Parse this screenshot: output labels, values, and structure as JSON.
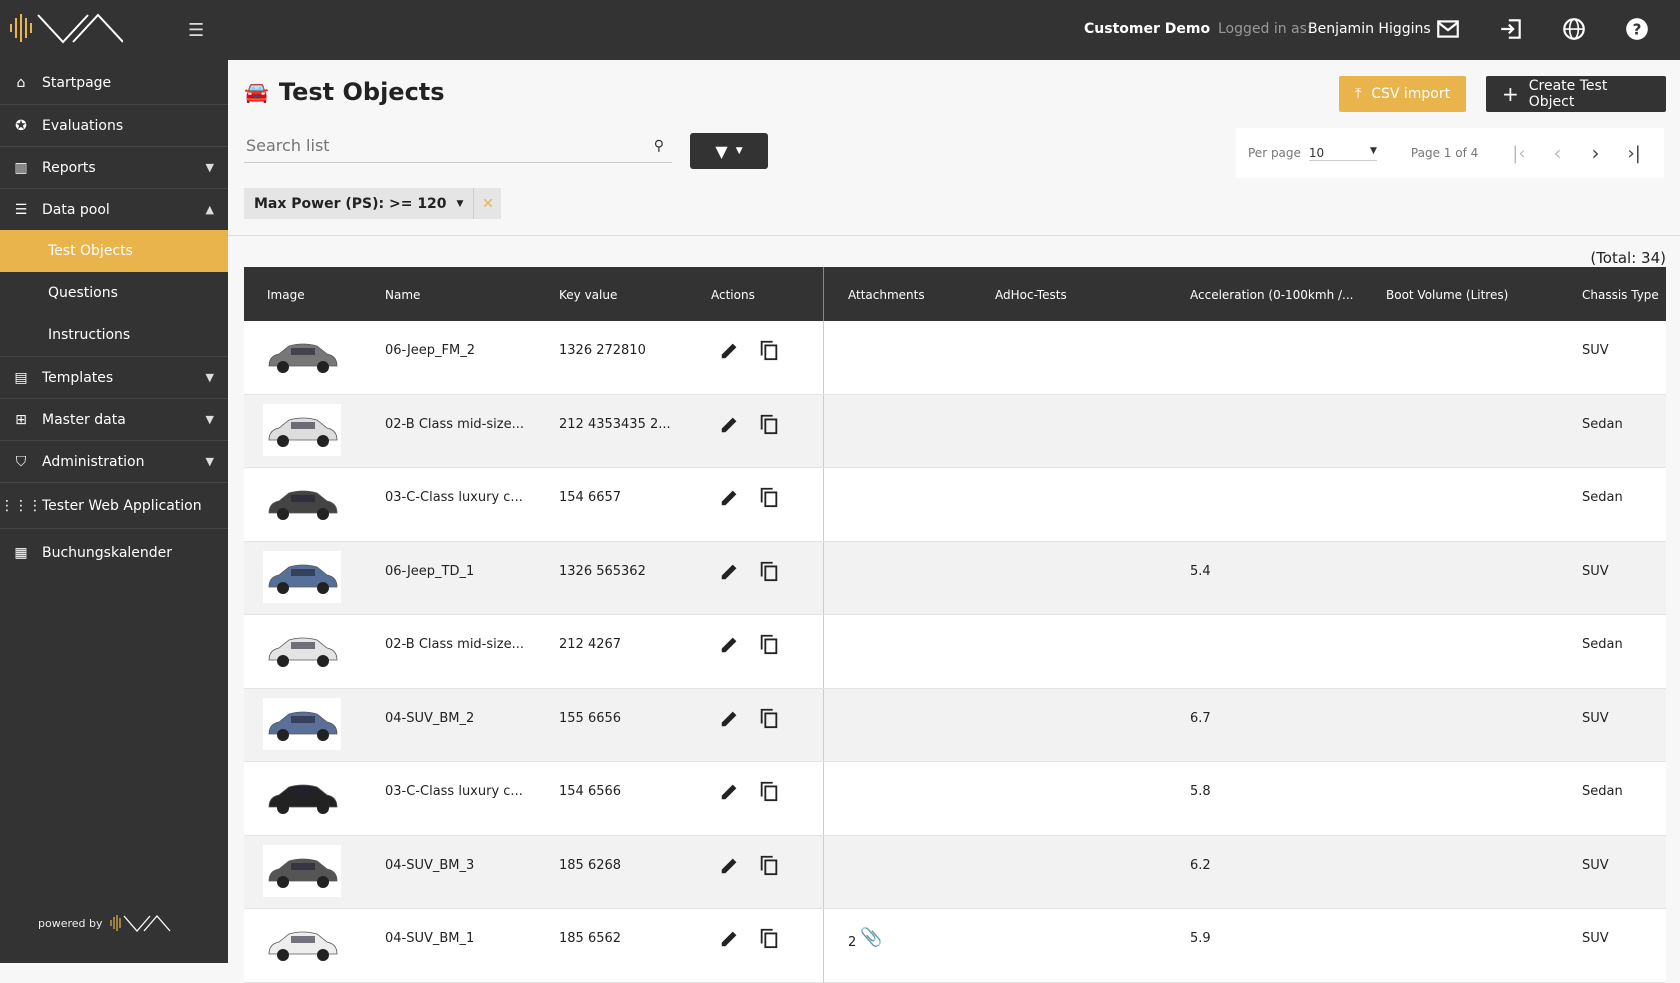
{
  "topbar": {
    "customer": "Customer Demo",
    "logged_in_label": "Logged in as:",
    "user": "Benjamin Higgins"
  },
  "sidebar": {
    "items": [
      {
        "label": "Startpage",
        "icon": "home-icon"
      },
      {
        "label": "Evaluations",
        "icon": "star-icon"
      },
      {
        "label": "Reports",
        "icon": "bar-chart-icon"
      },
      {
        "label": "Data pool",
        "icon": "list-icon"
      },
      {
        "label": "Templates",
        "icon": "template-icon"
      },
      {
        "label": "Master data",
        "icon": "hierarchy-icon"
      },
      {
        "label": "Administration",
        "icon": "shield-check-icon"
      },
      {
        "label": "Tester Web Application",
        "icon": "grid-icon"
      },
      {
        "label": "Buchungskalender",
        "icon": "calendar-icon"
      }
    ],
    "subitems": [
      "Test Objects",
      "Questions",
      "Instructions"
    ],
    "powered_by": "powered by"
  },
  "page": {
    "title": "Test Objects",
    "csv_import": "CSV import",
    "create": "Create Test Object",
    "search_placeholder": "Search list",
    "filter_chip": "Max Power (PS): >= 120",
    "per_page_label": "Per page",
    "per_page": "10",
    "page_info": "Page 1 of 4",
    "total": "(Total: 34)"
  },
  "colors": {
    "accent": "#e9b44c",
    "dark": "#333333"
  },
  "table": {
    "headers": [
      "Image",
      "Name",
      "Key value",
      "Actions",
      "Attachments",
      "AdHoc-Tests",
      "Acceleration (0-100kmh /...",
      "Boot Volume (Litres)",
      "Chassis Type"
    ],
    "rows": [
      {
        "name": "06-Jeep_FM_2",
        "key": "1326 272810",
        "attachments": "",
        "accel": "",
        "chassis": "SUV",
        "car_color": "#777"
      },
      {
        "name": "02-B Class mid-size...",
        "key": "212 4353435 2...",
        "attachments": "",
        "accel": "",
        "chassis": "Sedan",
        "car_color": "#ddd"
      },
      {
        "name": "03-C-Class luxury c...",
        "key": "154 6657",
        "attachments": "",
        "accel": "",
        "chassis": "Sedan",
        "car_color": "#444"
      },
      {
        "name": "06-Jeep_TD_1",
        "key": "1326 565362",
        "attachments": "",
        "accel": "5.4",
        "chassis": "SUV",
        "car_color": "#56709a"
      },
      {
        "name": "02-B Class mid-size...",
        "key": "212 4267",
        "attachments": "",
        "accel": "",
        "chassis": "Sedan",
        "car_color": "#e4e4e4"
      },
      {
        "name": "04-SUV_BM_2",
        "key": "155 6656",
        "attachments": "",
        "accel": "6.7",
        "chassis": "SUV",
        "car_color": "#5a7099"
      },
      {
        "name": "03-C-Class luxury c...",
        "key": "154 6566",
        "attachments": "",
        "accel": "5.8",
        "chassis": "Sedan",
        "car_color": "#222"
      },
      {
        "name": "04-SUV_BM_3",
        "key": "185 6268",
        "attachments": "",
        "accel": "6.2",
        "chassis": "SUV",
        "car_color": "#555"
      },
      {
        "name": "04-SUV_BM_1",
        "key": "185 6562",
        "attachments": "2",
        "accel": "5.9",
        "chassis": "SUV",
        "car_color": "#eee"
      }
    ]
  }
}
